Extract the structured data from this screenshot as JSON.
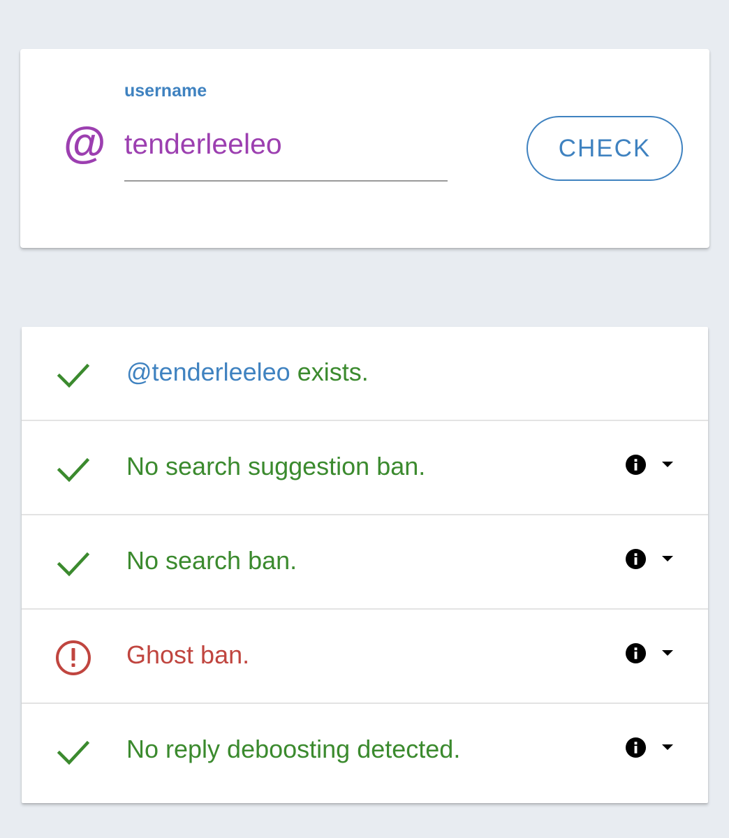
{
  "search": {
    "label": "username",
    "at_symbol": "@",
    "username_value": "tenderleeleo",
    "check_label": "CHECK"
  },
  "results": [
    {
      "status": "ok",
      "icon": "check-icon",
      "handle": "@tenderleeleo",
      "text": " exists."
    },
    {
      "status": "ok",
      "icon": "check-icon",
      "text": "No search suggestion ban."
    },
    {
      "status": "ok",
      "icon": "check-icon",
      "text": "No search ban."
    },
    {
      "status": "ban",
      "icon": "alert-circle-icon",
      "text": "Ghost ban."
    },
    {
      "status": "ok",
      "icon": "check-icon",
      "text": "No reply deboosting detected."
    }
  ],
  "colors": {
    "page_background": "#e8ecf1",
    "accent_blue": "#3f82c0",
    "accent_purple": "#9c3fb0",
    "ok_green": "#3b8a2e",
    "ban_red": "#c0453f"
  }
}
